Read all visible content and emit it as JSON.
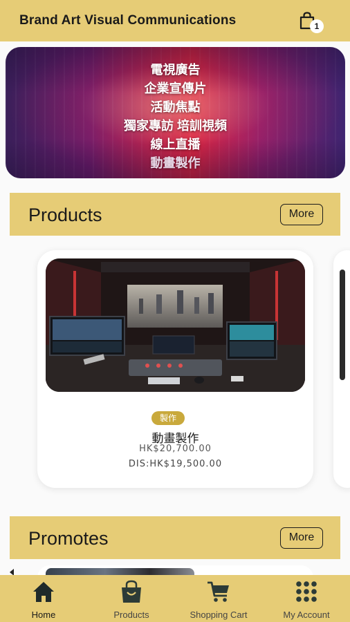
{
  "header": {
    "title": "Brand Art Visual Communications",
    "cart_count": "1"
  },
  "banner": {
    "lines": [
      "電視廣告",
      "企業宣傳片",
      "活動焦點",
      "獨家專訪 培訓視頻",
      "線上直播",
      "動畫製作"
    ]
  },
  "products_section": {
    "title": "Products",
    "more_label": "More",
    "items": [
      {
        "tag": "製作",
        "name": "動畫製作",
        "price": "HK$20,700.00",
        "discount_price": "DIS:HK$19,500.00"
      }
    ]
  },
  "promotes_section": {
    "title": "Promotes",
    "more_label": "More"
  },
  "bottom_nav": {
    "items": [
      {
        "label": "Home",
        "icon": "home-icon",
        "active": true
      },
      {
        "label": "Products",
        "icon": "shopping-bag-icon",
        "active": false
      },
      {
        "label": "Shopping Cart",
        "icon": "cart-icon",
        "active": false
      },
      {
        "label": "My Account",
        "icon": "grid-icon",
        "active": false
      }
    ]
  },
  "colors": {
    "accent": "#e6cc76",
    "tag": "#c9a93c",
    "text": "#1a1a1a"
  }
}
